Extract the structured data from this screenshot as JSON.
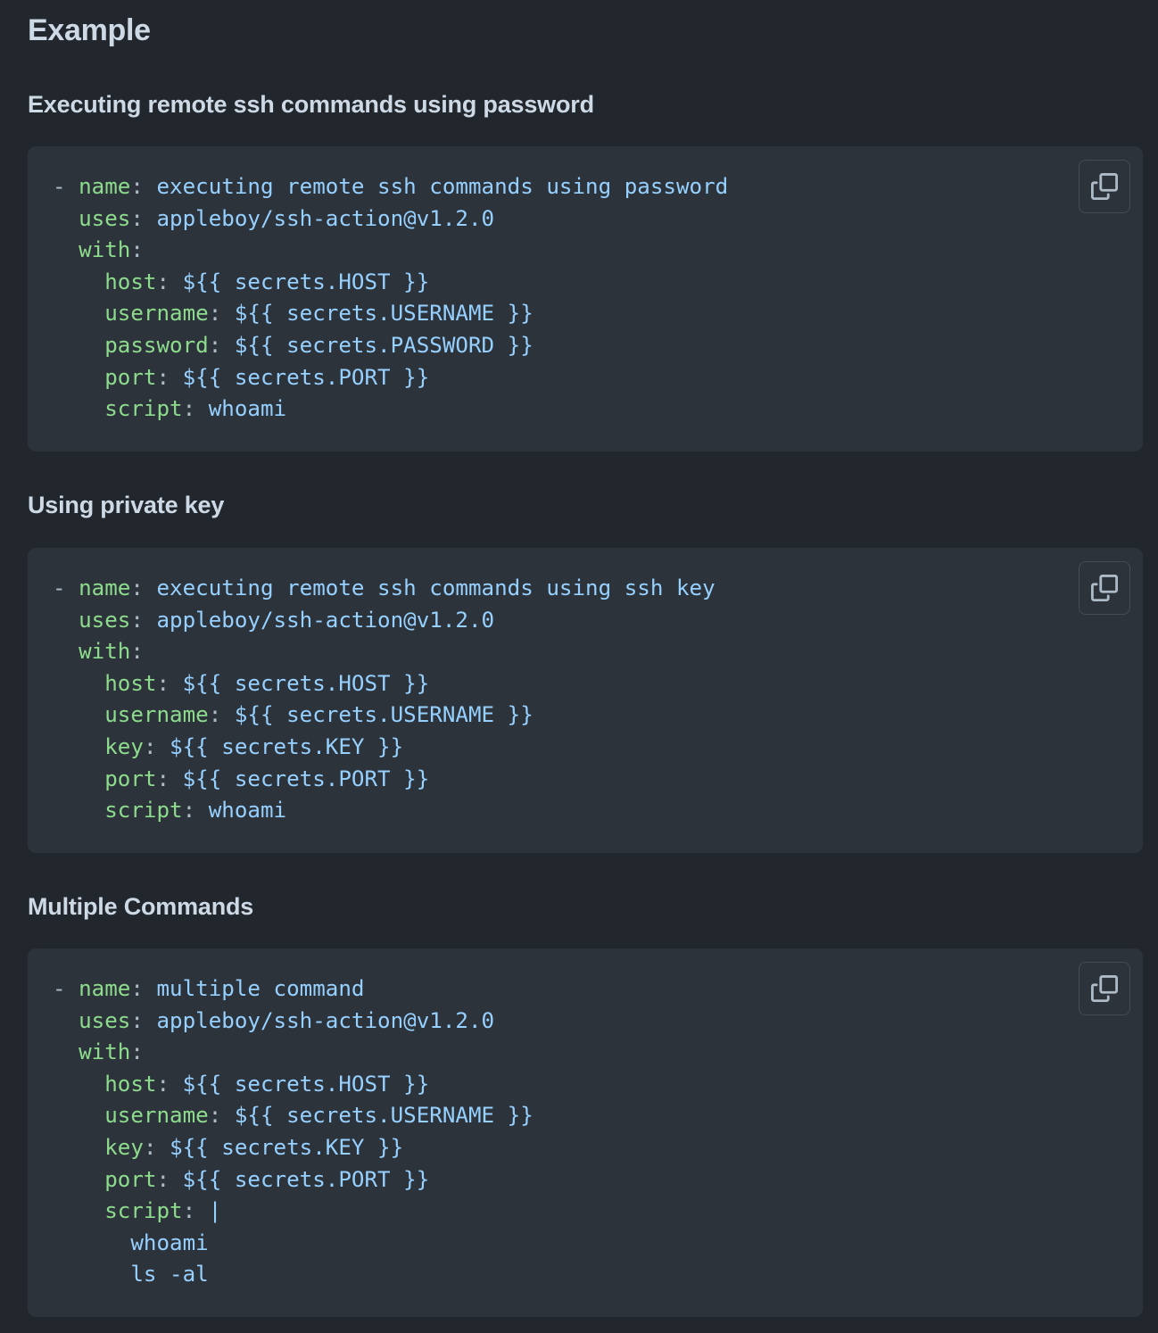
{
  "heading": "Example",
  "sections": [
    {
      "title": "Executing remote ssh commands using password",
      "lines": [
        [
          [
            "p",
            "- "
          ],
          [
            "k",
            "name"
          ],
          [
            "p",
            ": "
          ],
          [
            "v",
            "executing remote ssh commands using password"
          ]
        ],
        [
          [
            "p",
            "  "
          ],
          [
            "k",
            "uses"
          ],
          [
            "p",
            ": "
          ],
          [
            "v",
            "appleboy/ssh-action@v1.2.0"
          ]
        ],
        [
          [
            "p",
            "  "
          ],
          [
            "k",
            "with"
          ],
          [
            "p",
            ":"
          ]
        ],
        [
          [
            "p",
            "    "
          ],
          [
            "k",
            "host"
          ],
          [
            "p",
            ": "
          ],
          [
            "v",
            "${{ secrets.HOST }}"
          ]
        ],
        [
          [
            "p",
            "    "
          ],
          [
            "k",
            "username"
          ],
          [
            "p",
            ": "
          ],
          [
            "v",
            "${{ secrets.USERNAME }}"
          ]
        ],
        [
          [
            "p",
            "    "
          ],
          [
            "k",
            "password"
          ],
          [
            "p",
            ": "
          ],
          [
            "v",
            "${{ secrets.PASSWORD }}"
          ]
        ],
        [
          [
            "p",
            "    "
          ],
          [
            "k",
            "port"
          ],
          [
            "p",
            ": "
          ],
          [
            "v",
            "${{ secrets.PORT }}"
          ]
        ],
        [
          [
            "p",
            "    "
          ],
          [
            "k",
            "script"
          ],
          [
            "p",
            ": "
          ],
          [
            "v",
            "whoami"
          ]
        ]
      ]
    },
    {
      "title": "Using private key",
      "lines": [
        [
          [
            "p",
            "- "
          ],
          [
            "k",
            "name"
          ],
          [
            "p",
            ": "
          ],
          [
            "v",
            "executing remote ssh commands using ssh key"
          ]
        ],
        [
          [
            "p",
            "  "
          ],
          [
            "k",
            "uses"
          ],
          [
            "p",
            ": "
          ],
          [
            "v",
            "appleboy/ssh-action@v1.2.0"
          ]
        ],
        [
          [
            "p",
            "  "
          ],
          [
            "k",
            "with"
          ],
          [
            "p",
            ":"
          ]
        ],
        [
          [
            "p",
            "    "
          ],
          [
            "k",
            "host"
          ],
          [
            "p",
            ": "
          ],
          [
            "v",
            "${{ secrets.HOST }}"
          ]
        ],
        [
          [
            "p",
            "    "
          ],
          [
            "k",
            "username"
          ],
          [
            "p",
            ": "
          ],
          [
            "v",
            "${{ secrets.USERNAME }}"
          ]
        ],
        [
          [
            "p",
            "    "
          ],
          [
            "k",
            "key"
          ],
          [
            "p",
            ": "
          ],
          [
            "v",
            "${{ secrets.KEY }}"
          ]
        ],
        [
          [
            "p",
            "    "
          ],
          [
            "k",
            "port"
          ],
          [
            "p",
            ": "
          ],
          [
            "v",
            "${{ secrets.PORT }}"
          ]
        ],
        [
          [
            "p",
            "    "
          ],
          [
            "k",
            "script"
          ],
          [
            "p",
            ": "
          ],
          [
            "v",
            "whoami"
          ]
        ]
      ]
    },
    {
      "title": "Multiple Commands",
      "lines": [
        [
          [
            "p",
            "- "
          ],
          [
            "k",
            "name"
          ],
          [
            "p",
            ": "
          ],
          [
            "v",
            "multiple command"
          ]
        ],
        [
          [
            "p",
            "  "
          ],
          [
            "k",
            "uses"
          ],
          [
            "p",
            ": "
          ],
          [
            "v",
            "appleboy/ssh-action@v1.2.0"
          ]
        ],
        [
          [
            "p",
            "  "
          ],
          [
            "k",
            "with"
          ],
          [
            "p",
            ":"
          ]
        ],
        [
          [
            "p",
            "    "
          ],
          [
            "k",
            "host"
          ],
          [
            "p",
            ": "
          ],
          [
            "v",
            "${{ secrets.HOST }}"
          ]
        ],
        [
          [
            "p",
            "    "
          ],
          [
            "k",
            "username"
          ],
          [
            "p",
            ": "
          ],
          [
            "v",
            "${{ secrets.USERNAME }}"
          ]
        ],
        [
          [
            "p",
            "    "
          ],
          [
            "k",
            "key"
          ],
          [
            "p",
            ": "
          ],
          [
            "v",
            "${{ secrets.KEY }}"
          ]
        ],
        [
          [
            "p",
            "    "
          ],
          [
            "k",
            "port"
          ],
          [
            "p",
            ": "
          ],
          [
            "v",
            "${{ secrets.PORT }}"
          ]
        ],
        [
          [
            "p",
            "    "
          ],
          [
            "k",
            "script"
          ],
          [
            "p",
            ": "
          ],
          [
            "v",
            "|"
          ]
        ],
        [
          [
            "p",
            "      "
          ],
          [
            "v",
            "whoami"
          ]
        ],
        [
          [
            "p",
            "      "
          ],
          [
            "v",
            "ls -al"
          ]
        ]
      ]
    }
  ]
}
